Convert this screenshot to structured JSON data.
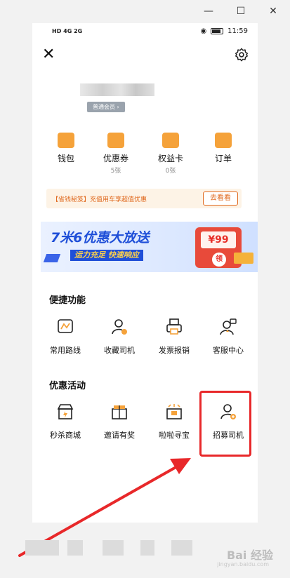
{
  "window_controls": {
    "minimize": "—",
    "maximize": "☐",
    "close": "✕"
  },
  "statusbar": {
    "network": "HD 4G 2G",
    "time": "11:59"
  },
  "header": {
    "close_icon": "close-icon",
    "settings_icon": "gear-icon"
  },
  "profile": {
    "member_badge": "普通会员 ›"
  },
  "quick": [
    {
      "label": "钱包",
      "sub": ""
    },
    {
      "label": "优惠券",
      "sub": "5张"
    },
    {
      "label": "权益卡",
      "sub": "0张"
    },
    {
      "label": "订单",
      "sub": ""
    }
  ],
  "promo": {
    "text": "【省钱秘笈】充值用车享超值优惠",
    "button": "去看看"
  },
  "banner": {
    "title": "7米6优惠大放送",
    "subtitle": "运力充足  快速响应",
    "coupon_amount": "¥99",
    "claim": "领"
  },
  "convenient": {
    "title": "便捷功能",
    "items": [
      {
        "label": "常用路线",
        "icon": "route-icon"
      },
      {
        "label": "收藏司机",
        "icon": "favorite-driver-icon"
      },
      {
        "label": "发票报销",
        "icon": "invoice-printer-icon"
      },
      {
        "label": "客服中心",
        "icon": "customer-service-icon"
      }
    ]
  },
  "activities": {
    "title": "优惠活动",
    "items": [
      {
        "label": "秒杀商城",
        "icon": "store-icon"
      },
      {
        "label": "邀请有奖",
        "icon": "gift-icon"
      },
      {
        "label": "啦啦寻宝",
        "icon": "treasure-icon"
      },
      {
        "label": "招募司机",
        "icon": "recruit-driver-icon"
      }
    ]
  },
  "watermark": {
    "text": "Bai 经验",
    "sub": "jingyan.baidu.com"
  },
  "colors": {
    "accent": "#f5a23a",
    "highlight": "#e8282a",
    "banner_blue": "#1f4fd8",
    "promo_orange": "#e0691e"
  }
}
